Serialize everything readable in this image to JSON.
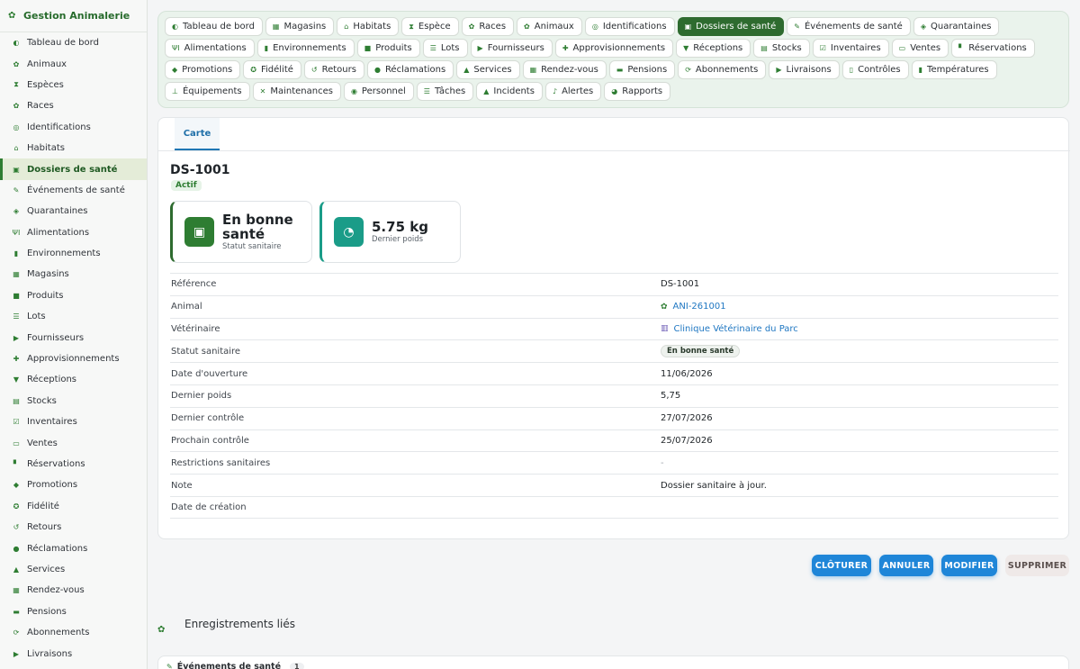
{
  "app": {
    "title": "Gestion Animalerie"
  },
  "sidebar": {
    "items": [
      {
        "label": "Tableau de bord",
        "icon": "dashboard-icon"
      },
      {
        "label": "Animaux",
        "icon": "paw-icon"
      },
      {
        "label": "Espèces",
        "icon": "dna-icon"
      },
      {
        "label": "Races",
        "icon": "paw-icon"
      },
      {
        "label": "Identifications",
        "icon": "fingerprint-icon"
      },
      {
        "label": "Habitats",
        "icon": "home-icon"
      },
      {
        "label": "Dossiers de santé",
        "icon": "medical-file-icon",
        "active": true
      },
      {
        "label": "Événements de santé",
        "icon": "syringe-icon"
      },
      {
        "label": "Quarantaines",
        "icon": "shield-icon"
      },
      {
        "label": "Alimentations",
        "icon": "utensils-icon"
      },
      {
        "label": "Environnements",
        "icon": "thermometer-icon"
      },
      {
        "label": "Magasins",
        "icon": "store-icon"
      },
      {
        "label": "Produits",
        "icon": "box-icon"
      },
      {
        "label": "Lots",
        "icon": "list-icon"
      },
      {
        "label": "Fournisseurs",
        "icon": "truck-icon"
      },
      {
        "label": "Approvisionnements",
        "icon": "supply-icon"
      },
      {
        "label": "Réceptions",
        "icon": "receive-icon"
      },
      {
        "label": "Stocks",
        "icon": "warehouse-icon"
      },
      {
        "label": "Inventaires",
        "icon": "clipboard-check-icon"
      },
      {
        "label": "Ventes",
        "icon": "cash-icon"
      },
      {
        "label": "Réservations",
        "icon": "bookmark-icon"
      },
      {
        "label": "Promotions",
        "icon": "tags-icon"
      },
      {
        "label": "Fidélité",
        "icon": "award-icon"
      },
      {
        "label": "Retours",
        "icon": "undo-icon"
      },
      {
        "label": "Réclamations",
        "icon": "comment-icon"
      },
      {
        "label": "Services",
        "icon": "bell-service-icon"
      },
      {
        "label": "Rendez-vous",
        "icon": "calendar-icon"
      },
      {
        "label": "Pensions",
        "icon": "bed-icon"
      },
      {
        "label": "Abonnements",
        "icon": "sync-icon"
      },
      {
        "label": "Livraisons",
        "icon": "delivery-icon"
      }
    ]
  },
  "topnav": {
    "tabs": [
      {
        "label": "Tableau de bord",
        "icon": "dashboard-icon"
      },
      {
        "label": "Magasins",
        "icon": "store-icon"
      },
      {
        "label": "Habitats",
        "icon": "home-icon"
      },
      {
        "label": "Espèce",
        "icon": "dna-icon"
      },
      {
        "label": "Races",
        "icon": "paw-icon"
      },
      {
        "label": "Animaux",
        "icon": "paw-icon"
      },
      {
        "label": "Identifications",
        "icon": "fingerprint-icon"
      },
      {
        "label": "Dossiers de santé",
        "icon": "medical-file-icon",
        "active": true
      },
      {
        "label": "Événements de santé",
        "icon": "syringe-icon"
      },
      {
        "label": "Quarantaines",
        "icon": "shield-icon"
      },
      {
        "label": "Alimentations",
        "icon": "utensils-icon"
      },
      {
        "label": "Environnements",
        "icon": "thermometer-icon"
      },
      {
        "label": "Produits",
        "icon": "box-icon"
      },
      {
        "label": "Lots",
        "icon": "list-icon"
      },
      {
        "label": "Fournisseurs",
        "icon": "truck-icon"
      },
      {
        "label": "Approvisionnements",
        "icon": "supply-icon"
      },
      {
        "label": "Réceptions",
        "icon": "receive-icon"
      },
      {
        "label": "Stocks",
        "icon": "warehouse-icon"
      },
      {
        "label": "Inventaires",
        "icon": "clipboard-check-icon"
      },
      {
        "label": "Ventes",
        "icon": "cash-icon"
      },
      {
        "label": "Réservations",
        "icon": "bookmark-icon"
      },
      {
        "label": "Promotions",
        "icon": "tags-icon"
      },
      {
        "label": "Fidélité",
        "icon": "award-icon"
      },
      {
        "label": "Retours",
        "icon": "undo-icon"
      },
      {
        "label": "Réclamations",
        "icon": "comment-icon"
      },
      {
        "label": "Services",
        "icon": "bell-service-icon"
      },
      {
        "label": "Rendez-vous",
        "icon": "calendar-icon"
      },
      {
        "label": "Pensions",
        "icon": "bed-icon"
      },
      {
        "label": "Abonnements",
        "icon": "sync-icon"
      },
      {
        "label": "Livraisons",
        "icon": "delivery-icon"
      },
      {
        "label": "Contrôles",
        "icon": "clipboard-icon"
      },
      {
        "label": "Températures",
        "icon": "thermometer-icon"
      },
      {
        "label": "Équipements",
        "icon": "plug-icon"
      },
      {
        "label": "Maintenances",
        "icon": "tools-icon"
      },
      {
        "label": "Personnel",
        "icon": "users-icon"
      },
      {
        "label": "Tâches",
        "icon": "tasks-icon"
      },
      {
        "label": "Incidents",
        "icon": "warning-icon"
      },
      {
        "label": "Alertes",
        "icon": "bell-icon"
      },
      {
        "label": "Rapports",
        "icon": "chart-pie-icon"
      }
    ]
  },
  "detail": {
    "tab_label": "Carte",
    "reference": "DS-1001",
    "status_badge": "Actif",
    "stats": [
      {
        "value": "En bonne santé",
        "label": "Statut sanitaire",
        "icon": "medical-file-icon",
        "color": "#2e7d32"
      },
      {
        "value": "5.75 kg",
        "label": "Dernier poids",
        "icon": "weight-scale-icon",
        "color": "#1a9c88"
      }
    ],
    "fields": [
      {
        "label": "Référence",
        "value": "DS-1001",
        "kind": "text"
      },
      {
        "label": "Animal",
        "value": "ANI-261001",
        "kind": "link",
        "icon": "paw-icon"
      },
      {
        "label": "Vétérinaire",
        "value": "Clinique Vétérinaire du Parc",
        "kind": "link",
        "icon": "building-icon"
      },
      {
        "label": "Statut sanitaire",
        "value": "En bonne santé",
        "kind": "pill"
      },
      {
        "label": "Date d'ouverture",
        "value": "11/06/2026",
        "kind": "text"
      },
      {
        "label": "Dernier poids",
        "value": "5,75",
        "kind": "text"
      },
      {
        "label": "Dernier contrôle",
        "value": "27/07/2026",
        "kind": "text"
      },
      {
        "label": "Prochain contrôle",
        "value": "25/07/2026",
        "kind": "text"
      },
      {
        "label": "Restrictions sanitaires",
        "value": "-",
        "kind": "muted"
      },
      {
        "label": "Note",
        "value": "Dossier sanitaire à jour.",
        "kind": "text"
      },
      {
        "label": "Date de création",
        "value": "",
        "kind": "text"
      }
    ]
  },
  "actions": {
    "close_label": "CLÔTURER",
    "cancel_label": "ANNULER",
    "edit_label": "MODIFIER",
    "delete_label": "SUPPRIMER"
  },
  "linked": {
    "title": "Enregistrements liés",
    "section_label": "Événements de santé",
    "section_count": "1"
  },
  "colors": {
    "brand": "#2e7d32",
    "action_blue": "#1f86d8"
  }
}
